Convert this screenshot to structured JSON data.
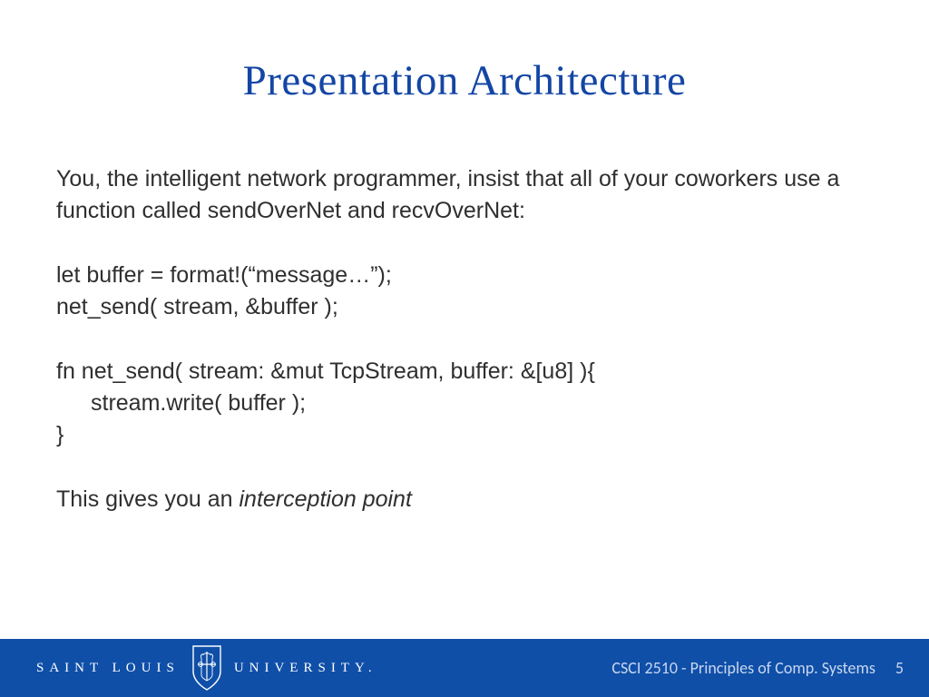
{
  "title": "Presentation Architecture",
  "body": {
    "intro": "You, the intelligent network programmer, insist that all of your coworkers use a function called sendOverNet and recvOverNet:",
    "code1a": "let buffer = format!(“message…”);",
    "code1b": "net_send( stream, &buffer );",
    "fn_open": "fn net_send( stream: &mut TcpStream, buffer: &[u8]  ){",
    "fn_body": "stream.write( buffer );",
    "fn_close": "}",
    "outro_pre": "This gives you an ",
    "outro_em": "interception point"
  },
  "footer": {
    "org_left": "SAINT LOUIS",
    "org_right": "UNIVERSITY.",
    "course": "CSCI 2510 - Principles of Comp. Systems",
    "page": "5"
  }
}
